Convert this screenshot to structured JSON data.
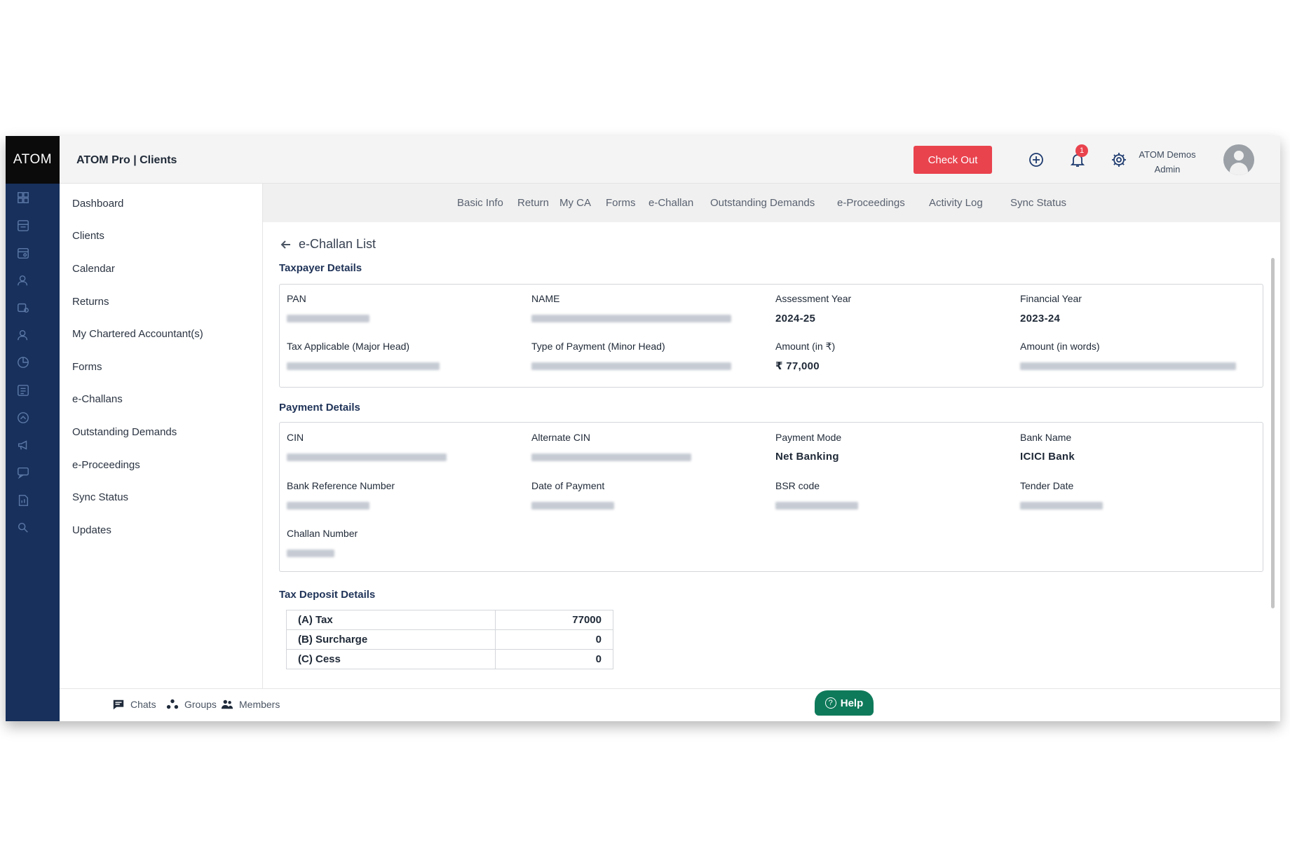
{
  "brand": {
    "logo_text": "ATOM",
    "app_title": "ATOM Pro | Clients"
  },
  "header": {
    "checkout_label": "Check Out",
    "notification_count": "1",
    "user_name": "ATOM Demos",
    "user_role": "Admin"
  },
  "sidebar": {
    "items": [
      {
        "label": "Dashboard",
        "icon": "dashboard-icon"
      },
      {
        "label": "Clients",
        "icon": "clients-icon"
      },
      {
        "label": "Calendar",
        "icon": "calendar-icon"
      },
      {
        "label": "Returns",
        "icon": "returns-icon"
      },
      {
        "label": "My Chartered Accountant(s)",
        "icon": "ca-icon"
      },
      {
        "label": "Forms",
        "icon": "forms-icon"
      },
      {
        "label": "e-Challans",
        "icon": "challan-icon"
      },
      {
        "label": "Outstanding Demands",
        "icon": "demands-icon"
      },
      {
        "label": "e-Proceedings",
        "icon": "proceedings-icon"
      },
      {
        "label": "Sync Status",
        "icon": "sync-icon"
      },
      {
        "label": "Updates",
        "icon": "updates-icon"
      }
    ]
  },
  "tabs": [
    {
      "label": "Basic Info"
    },
    {
      "label": "Return"
    },
    {
      "label": "My CA"
    },
    {
      "label": "Forms"
    },
    {
      "label": "e-Challan"
    },
    {
      "label": "Outstanding Demands"
    },
    {
      "label": "e-Proceedings"
    },
    {
      "label": "Activity Log"
    },
    {
      "label": "Sync Status"
    }
  ],
  "page": {
    "back_label": "e-Challan List"
  },
  "taxpayer": {
    "title": "Taxpayer Details",
    "pan_label": "PAN",
    "name_label": "NAME",
    "ay_label": "Assessment Year",
    "ay_value": "2024-25",
    "fy_label": "Financial Year",
    "fy_value": "2023-24",
    "major_head_label": "Tax Applicable (Major Head)",
    "minor_head_label": "Type of Payment (Minor Head)",
    "amount_label": "Amount (in ₹)",
    "amount_value": "₹ 77,000",
    "amount_words_label": "Amount (in words)"
  },
  "payment": {
    "title": "Payment Details",
    "cin_label": "CIN",
    "alt_cin_label": "Alternate CIN",
    "mode_label": "Payment Mode",
    "mode_value": "Net Banking",
    "bank_label": "Bank Name",
    "bank_value": "ICICI Bank",
    "bank_ref_label": "Bank Reference Number",
    "date_label": "Date of Payment",
    "bsr_label": "BSR code",
    "tender_label": "Tender Date",
    "challan_label": "Challan Number"
  },
  "deposit": {
    "title": "Tax Deposit Details",
    "rows": [
      {
        "label": "(A) Tax",
        "value": "77000"
      },
      {
        "label": "(B) Surcharge",
        "value": "0"
      },
      {
        "label": "(C) Cess",
        "value": "0"
      }
    ]
  },
  "footer": {
    "chats_label": "Chats",
    "groups_label": "Groups",
    "members_label": "Members",
    "help_label": "Help"
  }
}
